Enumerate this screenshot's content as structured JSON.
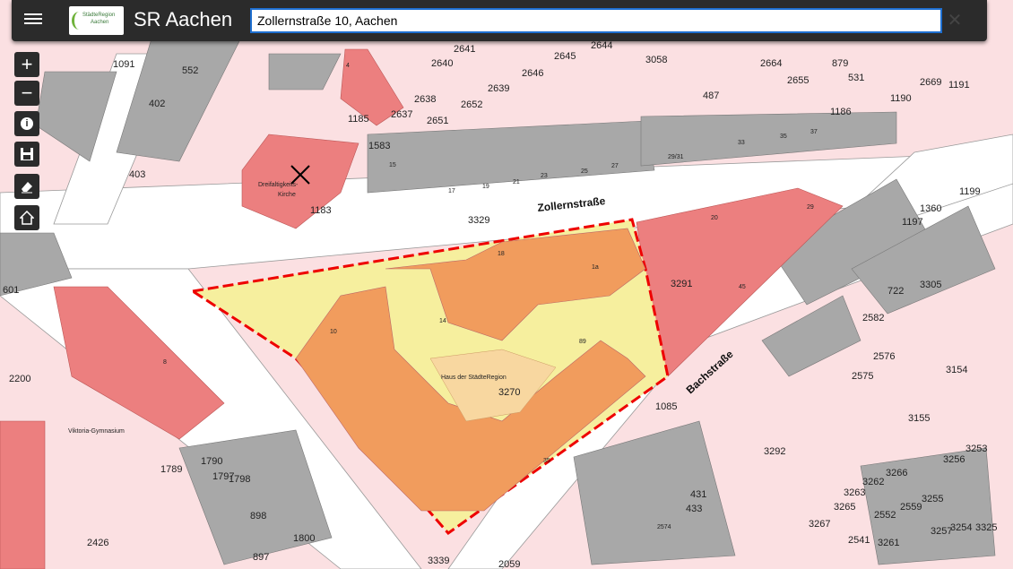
{
  "header": {
    "app_title": "SR Aachen",
    "logo_text_1": "StädteRegion",
    "logo_text_2": "Aachen"
  },
  "search": {
    "value": "Zollernstraße 10, Aachen",
    "clear_icon": "close-icon"
  },
  "tools": [
    {
      "name": "zoom-in",
      "icon": "plus-icon"
    },
    {
      "name": "zoom-out",
      "icon": "minus-icon"
    },
    {
      "name": "info",
      "icon": "info-icon"
    },
    {
      "name": "save",
      "icon": "save-icon"
    },
    {
      "name": "erase",
      "icon": "eraser-icon"
    },
    {
      "name": "home",
      "icon": "home-icon"
    }
  ],
  "map": {
    "streets": {
      "zollernstrasse": "Zollernstraße",
      "bachstrasse": "Bachstraße"
    },
    "places": {
      "church": "Dreifaltigkeits-Kirche",
      "church_1": "Dreifaltigkeits-",
      "church_2": "Kirche",
      "haus": "Haus der StädteRegion",
      "gymnasium": "Viktoria-Gymnasium"
    },
    "parcels": {
      "p3270": "3270",
      "p3329": "3329",
      "p3291": "3291",
      "p3292": "3292",
      "p1085": "1085",
      "p1183": "1183",
      "p1185": "1185",
      "p1583": "1583",
      "p2637": "2637",
      "p2638": "2638",
      "p2651": "2651",
      "p2652": "2652",
      "p2639": "2639",
      "p2641": "2641",
      "p2640": "2640",
      "p2646": "2646",
      "p2644": "2644",
      "p2645": "2645",
      "p3058": "3058",
      "p487": "487",
      "p2664": "2664",
      "p879": "879",
      "p531": "531",
      "p2655": "2655",
      "p1190": "1190",
      "p2669": "2669",
      "p1191": "1191",
      "p1186": "1186",
      "p1091": "1091",
      "p552": "552",
      "p402": "402",
      "p403": "403",
      "p601": "601",
      "p2200": "2200",
      "p1199": "1199",
      "p1360": "1360",
      "p1197": "1197",
      "p722": "722",
      "p3305": "3305",
      "p2582": "2582",
      "p2576": "2576",
      "p2575": "2575",
      "p3154": "3154",
      "p3155": "3155",
      "p3253": "3253",
      "p3256": "3256",
      "p3266": "3266",
      "p3262": "3262",
      "p3263": "3263",
      "p3265": "3265",
      "p2552": "2552",
      "p2559": "2559",
      "p3267": "3267",
      "p2541": "2541",
      "p3261": "3261",
      "p3257": "3257",
      "p3254": "3254",
      "p3255": "3255",
      "p3325": "3325",
      "p1790": "1790",
      "p1798": "1798",
      "p1797": "1797",
      "p1789": "1789",
      "p898": "898",
      "p897": "897",
      "p1800": "1800",
      "p2426": "2426",
      "p431": "431",
      "p433": "433",
      "p2574": "2574",
      "p2059": "2059",
      "p3339": "3339"
    },
    "house_numbers": {
      "n4": "4",
      "n18": "18",
      "n1a": "1a",
      "n14": "14",
      "n10": "10",
      "n89": "89",
      "n35": "35",
      "n20": "20",
      "n29": "29",
      "n45": "45",
      "n17": "17",
      "n19": "19",
      "n21": "21",
      "n23": "23",
      "n25": "25",
      "n27": "27",
      "n2931": "29/31",
      "n33": "33",
      "n35b": "35",
      "n37": "37",
      "n15": "15",
      "n8": "8"
    }
  }
}
